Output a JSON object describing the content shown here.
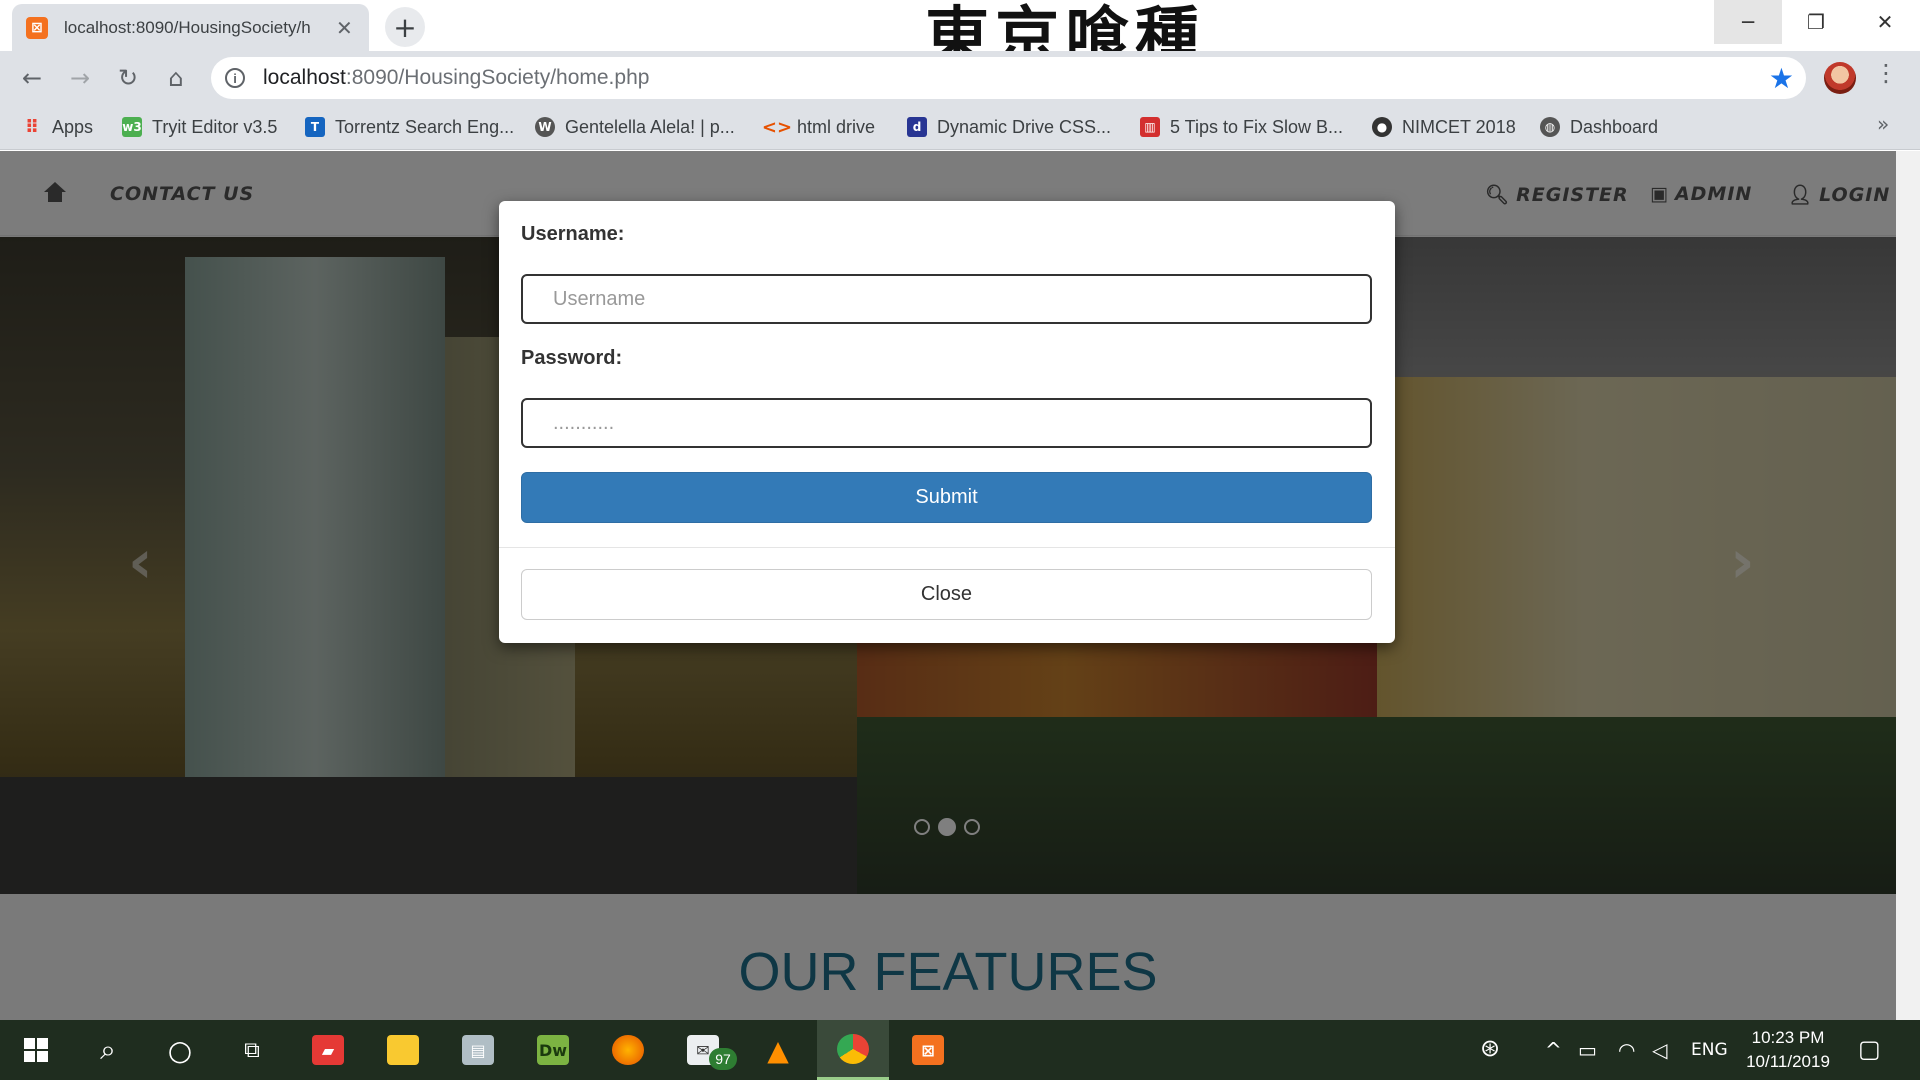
{
  "browser": {
    "tab_title": "localhost:8090/HousingSociety/h",
    "title_art": "東京喰種",
    "url_host": "localhost",
    "url_rest": ":8090/HousingSociety/home.php",
    "bookmarks": [
      {
        "label": "Apps",
        "icon": "apps-grid-icon",
        "color": "#ea4335"
      },
      {
        "label": "Tryit Editor v3.5",
        "icon": "w3schools-icon",
        "color": "#4caf50"
      },
      {
        "label": "Torrentz Search Eng...",
        "icon": "torrentz-icon",
        "color": "#1565c0"
      },
      {
        "label": "Gentelella Alela! | p...",
        "icon": "wordpress-icon",
        "color": "#555555"
      },
      {
        "label": "html drive",
        "icon": "code-brackets-icon",
        "color": "#e65100"
      },
      {
        "label": "Dynamic Drive CSS...",
        "icon": "dynamic-drive-icon",
        "color": "#283593"
      },
      {
        "label": "5 Tips to Fix Slow B...",
        "icon": "tips-icon",
        "color": "#d32f2f"
      },
      {
        "label": "NIMCET 2018",
        "icon": "nimcet-icon",
        "color": "#333333"
      },
      {
        "label": "Dashboard",
        "icon": "globe-icon",
        "color": "#555555"
      }
    ]
  },
  "site": {
    "nav": {
      "contact": "CONTACT US",
      "register": "REGISTER",
      "admin": "ADMIN",
      "login": "LOGIN"
    },
    "features_heading": "OUR FEATURES"
  },
  "modal": {
    "username_label": "Username:",
    "username_placeholder": "Username",
    "password_label": "Password:",
    "password_placeholder": "...........",
    "submit_label": "Submit",
    "close_label": "Close"
  },
  "taskbar": {
    "mail_badge": "97",
    "language": "ENG",
    "time": "10:23 PM",
    "date": "10/11/2019"
  }
}
